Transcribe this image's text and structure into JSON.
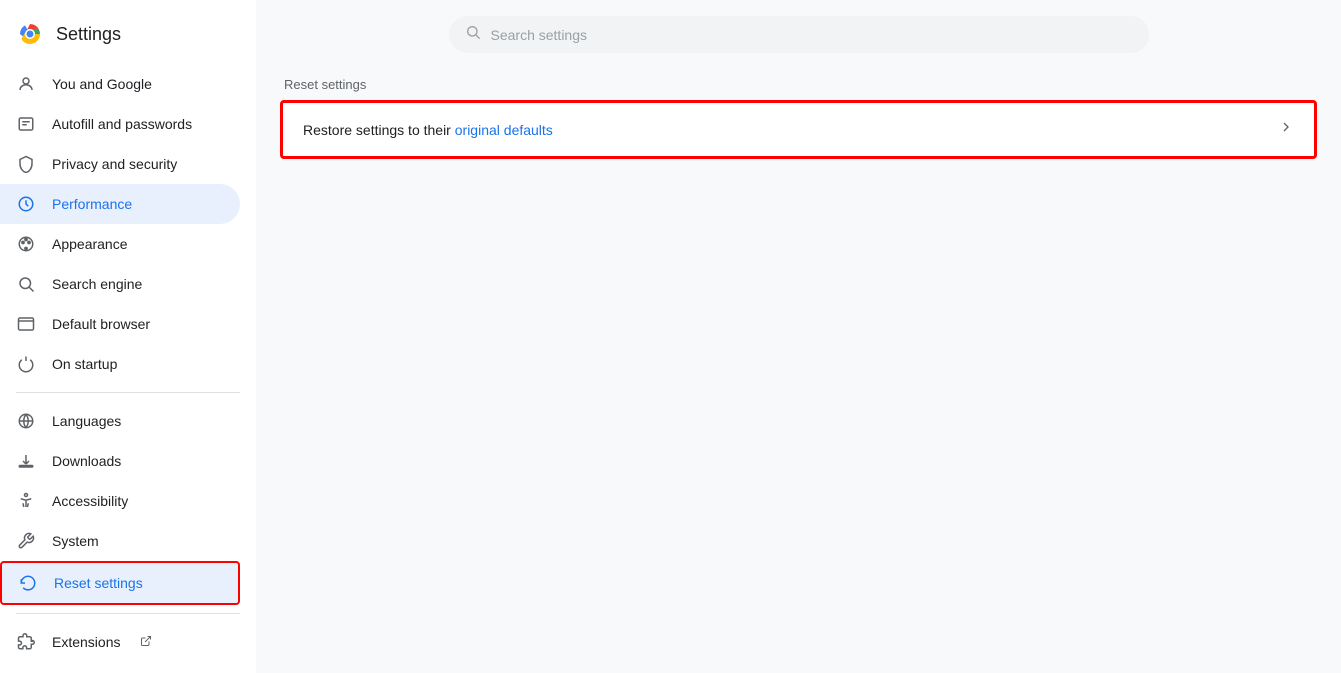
{
  "app": {
    "title": "Settings"
  },
  "search": {
    "placeholder": "Search settings"
  },
  "sidebar": {
    "items": [
      {
        "id": "you-and-google",
        "label": "You and Google",
        "icon": "person",
        "active": false,
        "highlighted": false
      },
      {
        "id": "autofill-passwords",
        "label": "Autofill and passwords",
        "icon": "badge",
        "active": false,
        "highlighted": false
      },
      {
        "id": "privacy-security",
        "label": "Privacy and security",
        "icon": "shield",
        "active": false,
        "highlighted": false
      },
      {
        "id": "performance",
        "label": "Performance",
        "icon": "speed",
        "active": true,
        "highlighted": false
      },
      {
        "id": "appearance",
        "label": "Appearance",
        "icon": "palette",
        "active": false,
        "highlighted": false
      },
      {
        "id": "search-engine",
        "label": "Search engine",
        "icon": "search",
        "active": false,
        "highlighted": false
      },
      {
        "id": "default-browser",
        "label": "Default browser",
        "icon": "browser",
        "active": false,
        "highlighted": false
      },
      {
        "id": "on-startup",
        "label": "On startup",
        "icon": "power",
        "active": false,
        "highlighted": false
      }
    ],
    "items2": [
      {
        "id": "languages",
        "label": "Languages",
        "icon": "globe",
        "active": false,
        "highlighted": false
      },
      {
        "id": "downloads",
        "label": "Downloads",
        "icon": "download",
        "active": false,
        "highlighted": false
      },
      {
        "id": "accessibility",
        "label": "Accessibility",
        "icon": "accessibility",
        "active": false,
        "highlighted": false
      },
      {
        "id": "system",
        "label": "System",
        "icon": "wrench",
        "active": false,
        "highlighted": false
      },
      {
        "id": "reset-settings",
        "label": "Reset settings",
        "icon": "reset",
        "active": false,
        "highlighted": true
      }
    ],
    "items3": [
      {
        "id": "extensions",
        "label": "Extensions",
        "icon": "puzzle",
        "external": true,
        "active": false,
        "highlighted": false
      }
    ]
  },
  "main": {
    "section_title": "Reset settings",
    "card_item": {
      "text_before": "Restore settings to their ",
      "link_text": "original defaults",
      "text_after": ""
    }
  }
}
